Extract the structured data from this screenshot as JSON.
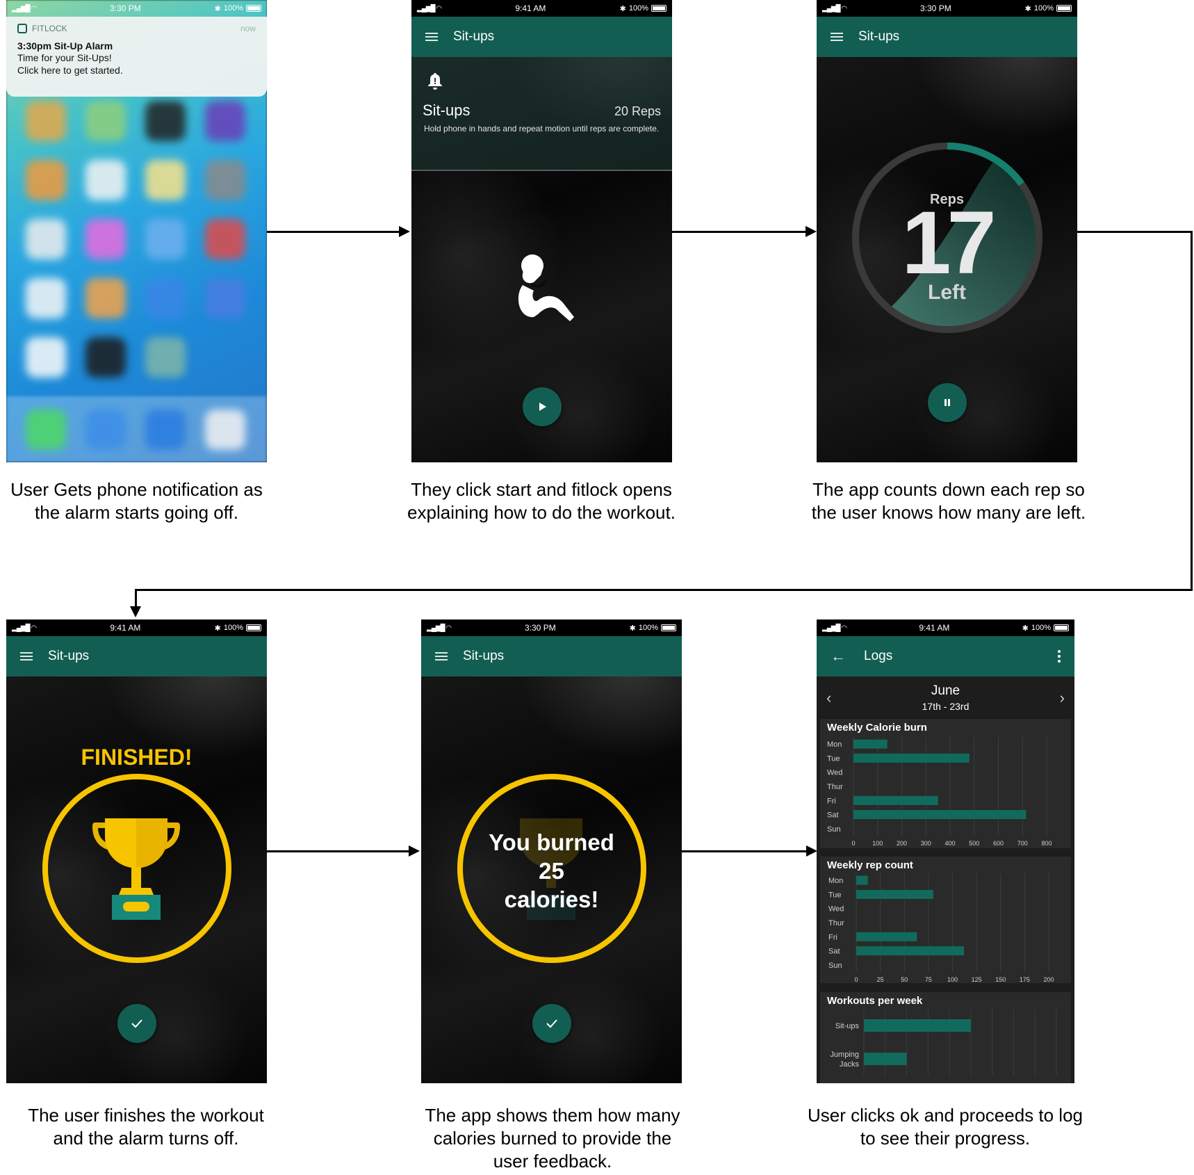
{
  "colors": {
    "teal": "#135e52",
    "gold": "#f7c400",
    "bar": "#116b5d"
  },
  "screens": [
    {
      "id": "notification",
      "status": {
        "time": "3:30 PM",
        "battery": "100%"
      },
      "notification": {
        "app": "FITLOCK",
        "time": "now",
        "title": "3:30pm Sit-Up Alarm",
        "body_line1": "Time for your Sit-Ups!",
        "body_line2": "Click here to get started."
      },
      "caption": "User Gets phone notification as the alarm starts going off."
    },
    {
      "id": "instructions",
      "status": {
        "time": "9:41 AM",
        "battery": "100%"
      },
      "appbar_title": "Sit-ups",
      "workout": {
        "name": "Sit-ups",
        "reps": "20 Reps",
        "description": "Hold phone in hands and repeat motion until reps are complete."
      },
      "icons": [
        "bell-icon",
        "situp-figure-icon",
        "play-icon"
      ],
      "caption": "They click start and fitlock opens explaining how to do the workout."
    },
    {
      "id": "countdown",
      "status": {
        "time": "3:30 PM",
        "battery": "100%"
      },
      "appbar_title": "Sit-ups",
      "counter": {
        "label": "Reps",
        "value": "17",
        "suffix": "Left",
        "total": 20
      },
      "icons": [
        "pause-icon"
      ],
      "caption": "The app counts down each rep so the user knows how many are left."
    },
    {
      "id": "finished",
      "status": {
        "time": "9:41 AM",
        "battery": "100%"
      },
      "appbar_title": "Sit-ups",
      "heading": "FINISHED!",
      "icons": [
        "trophy-icon",
        "check-icon"
      ],
      "caption": "The user finishes the workout and the alarm turns off."
    },
    {
      "id": "calories",
      "status": {
        "time": "3:30 PM",
        "battery": "100%"
      },
      "appbar_title": "Sit-ups",
      "message_line1": "You burned",
      "message_line2": "25",
      "message_line3": "calories!",
      "icons": [
        "check-icon"
      ],
      "caption": "The app shows them how many calories burned to provide the user feedback."
    },
    {
      "id": "logs",
      "status": {
        "time": "9:41 AM",
        "battery": "100%"
      },
      "appbar_title": "Logs",
      "week": {
        "month": "June",
        "range": "17th - 23rd"
      },
      "caption": "User clicks ok and proceeds to log to see their progress."
    }
  ],
  "chart_data": [
    {
      "type": "bar",
      "orientation": "horizontal",
      "title": "Weekly Calorie burn",
      "categories": [
        "Mon",
        "Tue",
        "Wed",
        "Thur",
        "Fri",
        "Sat",
        "Sun"
      ],
      "values": [
        140,
        480,
        0,
        0,
        350,
        715,
        0
      ],
      "xticks": [
        "0",
        "100",
        "200",
        "300",
        "400",
        "500",
        "600",
        "700",
        "800"
      ],
      "xlim": [
        0,
        800
      ],
      "grid": true
    },
    {
      "type": "bar",
      "orientation": "horizontal",
      "title": "Weekly rep count",
      "categories": [
        "Mon",
        "Tue",
        "Wed",
        "Thur",
        "Fri",
        "Sat",
        "Sun"
      ],
      "values": [
        12,
        80,
        0,
        0,
        63,
        112,
        0
      ],
      "xticks": [
        "0",
        "25",
        "50",
        "75",
        "100",
        "125",
        "150",
        "175",
        "200"
      ],
      "xlim": [
        0,
        200
      ],
      "grid": true
    },
    {
      "type": "bar",
      "orientation": "horizontal",
      "title": "Workouts per week",
      "categories": [
        "Sit-ups",
        "Jumping Jacks"
      ],
      "values": [
        5,
        2
      ],
      "xlim": [
        0,
        9
      ],
      "grid": true
    }
  ]
}
